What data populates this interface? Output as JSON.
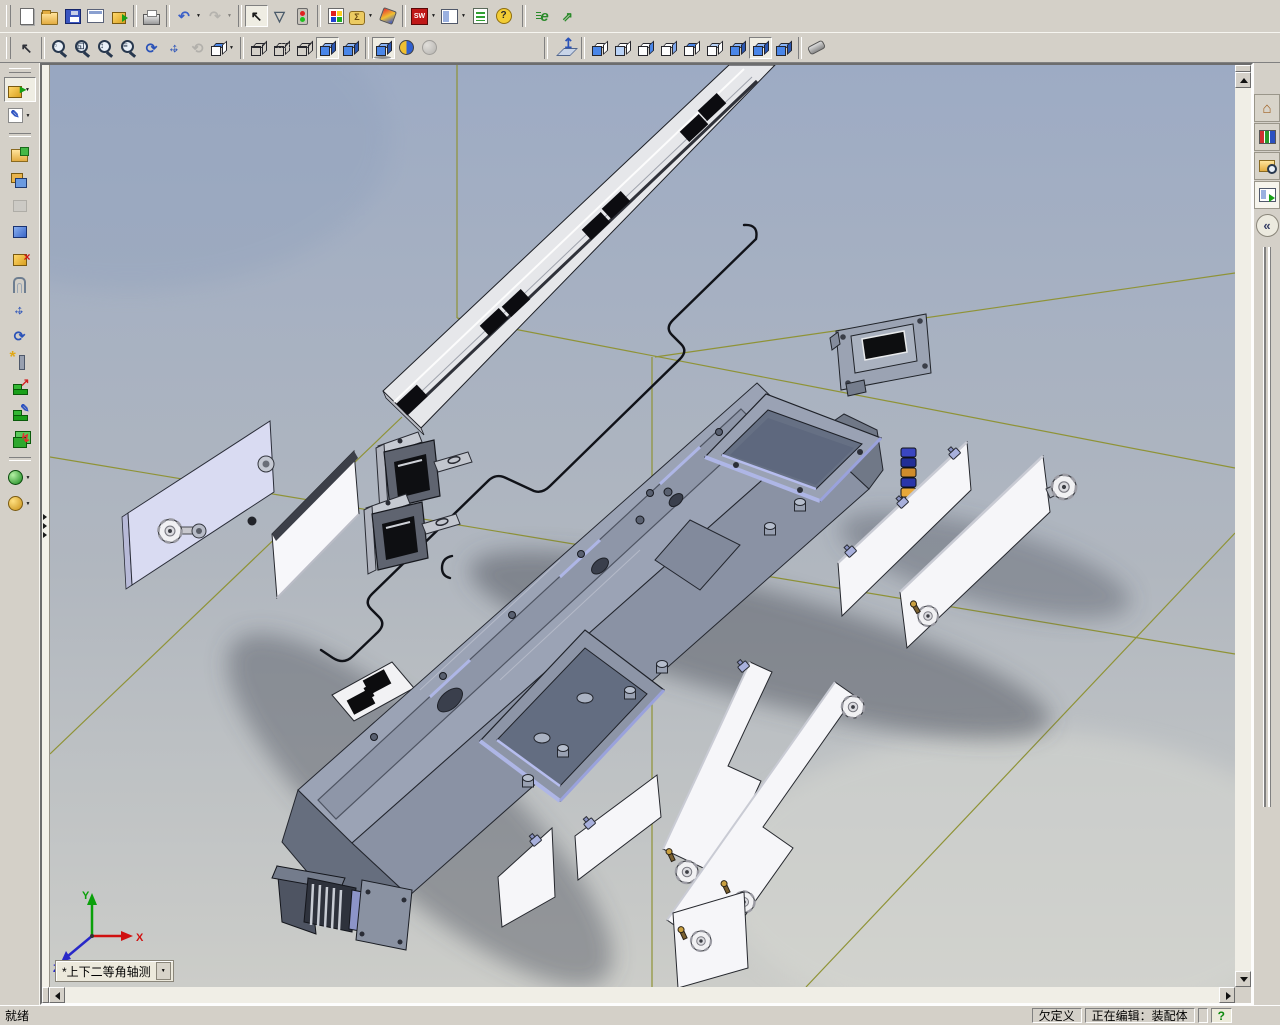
{
  "ui": {
    "dropdown_glyph": "▼"
  },
  "toolbar_main": {
    "items": [
      {
        "grip": true
      },
      {
        "name": "new-button",
        "icon": "new-document-icon",
        "kind": "page"
      },
      {
        "name": "open-button",
        "icon": "open-folder-icon",
        "kind": "folder"
      },
      {
        "name": "save-button",
        "icon": "save-disk-icon",
        "kind": "disk"
      },
      {
        "name": "make-drawing-button",
        "icon": "make-drawing-icon",
        "kind": "drawing"
      },
      {
        "name": "make-assembly-button",
        "icon": "make-assembly-icon",
        "kind": "partgreen"
      },
      {
        "sep": true
      },
      {
        "name": "print-button",
        "icon": "printer-icon",
        "kind": "print"
      },
      {
        "sep": true
      },
      {
        "name": "undo-button",
        "icon": "undo-arrow-icon",
        "char": "↶",
        "color": "#3a5fc8",
        "dropdown": true
      },
      {
        "name": "redo-button",
        "icon": "redo-arrow-icon",
        "char": "↷",
        "color": "#90908a",
        "disabled": true,
        "dropdown": true
      },
      {
        "sep": true
      },
      {
        "name": "select-button",
        "icon": "cursor-arrow-icon",
        "char": "↖",
        "color": "#1a1a1a",
        "pressed": true
      },
      {
        "name": "selection-filter-button",
        "icon": "filter-funnel-icon",
        "char": "▽",
        "color": "#4a5a6a"
      },
      {
        "name": "rebuild-button",
        "icon": "traffic-light-icon",
        "kind": "traffic"
      },
      {
        "sep": true
      },
      {
        "name": "edit-color-button",
        "icon": "color-palette-icon",
        "kind": "palette"
      },
      {
        "name": "measure-button",
        "icon": "measure-tape-icon",
        "kind": "measure",
        "char": "Σ",
        "color": "#6a4a10",
        "dropdown": true
      },
      {
        "name": "photoworks-button",
        "icon": "render-icon",
        "kind": "pworks"
      },
      {
        "sep": true
      },
      {
        "name": "solidworks-office-button",
        "icon": "solidworks-logo-icon",
        "kind": "sw",
        "char": "SW",
        "color": "#ffffff",
        "dropdown": true
      },
      {
        "name": "view-layout-button",
        "icon": "split-window-icon",
        "kind": "window",
        "dropdown": true
      },
      {
        "name": "options-button",
        "icon": "options-list-icon",
        "kind": "options"
      },
      {
        "name": "help-button",
        "icon": "help-question-icon",
        "kind": "help",
        "char": "?",
        "color": "#2a2a2a"
      },
      {
        "bigsep": true
      },
      {
        "name": "edrawings-button",
        "icon": "edrawings-e-icon",
        "kind": "e",
        "char": "e",
        "color": "#2a8a2a"
      },
      {
        "name": "web-publish-button",
        "icon": "web-arrows-icon",
        "kind": "web",
        "char": "⇗",
        "color": "#2a8a2a"
      }
    ]
  },
  "toolbar_view": {
    "items": [
      {
        "grip": true
      },
      {
        "name": "select-tool-button",
        "icon": "cursor-spring-icon",
        "char": "↖",
        "color": "#2e3038"
      },
      {
        "sep": true
      },
      {
        "name": "zoom-fit-button",
        "icon": "magnifier-fit-icon",
        "kind": "mag",
        "char": "▫"
      },
      {
        "name": "zoom-area-button",
        "icon": "magnifier-area-icon",
        "kind": "mag",
        "char": "◱"
      },
      {
        "name": "zoom-in-out-button",
        "icon": "magnifier-inout-icon",
        "kind": "mag",
        "char": "↕"
      },
      {
        "name": "zoom-selection-button",
        "icon": "magnifier-selection-icon",
        "kind": "mag",
        "char": "≡"
      },
      {
        "name": "rotate-view-button",
        "icon": "rotate-arrows-icon",
        "char": "⟳",
        "color": "#2a52b8"
      },
      {
        "name": "pan-button",
        "icon": "pan-arrows-icon",
        "kind": "pan"
      },
      {
        "name": "rotate-about-axis-button",
        "icon": "orbit-icon",
        "char": "⟲",
        "color": "#8a8a86",
        "disabled": true
      },
      {
        "name": "standard-views-button",
        "icon": "views-cube-icon",
        "cube": "faceT",
        "dropdown": true
      },
      {
        "sep": true
      },
      {
        "name": "wireframe-button",
        "icon": "wireframe-cube-icon",
        "cube": "wire"
      },
      {
        "name": "hidden-lines-visible-button",
        "icon": "hlv-cube-icon",
        "cube": "hlv"
      },
      {
        "name": "hidden-lines-removed-button",
        "icon": "hlr-cube-icon",
        "cube": "wire"
      },
      {
        "name": "shaded-with-edges-button",
        "icon": "shaded-edges-cube-icon",
        "cube": "edge",
        "pressed": true
      },
      {
        "name": "shaded-button",
        "icon": "shaded-cube-icon",
        "cube": "solid"
      },
      {
        "sep": true
      },
      {
        "name": "shadows-button",
        "icon": "shadow-cube-icon",
        "cube": "shadow",
        "pressed": true
      },
      {
        "name": "section-view-button",
        "icon": "section-view-icon",
        "kind": "section"
      },
      {
        "name": "realview-button",
        "icon": "realview-sphere-icon",
        "kind": "sphere",
        "disabled": true
      },
      {
        "gap": 96
      },
      {
        "bigsep": true
      },
      {
        "name": "normal-to-button",
        "icon": "normal-to-icon",
        "kind": "normalto",
        "char": "↥",
        "color": "#2a52b8"
      },
      {
        "sep": true
      },
      {
        "name": "front-view-button",
        "icon": "front-view-cube-icon",
        "cube": "faceF"
      },
      {
        "name": "back-view-button",
        "icon": "back-view-cube-icon",
        "cube": "faceB"
      },
      {
        "name": "left-view-button",
        "icon": "left-view-cube-icon",
        "cube": "faceL"
      },
      {
        "name": "right-view-button",
        "icon": "right-view-cube-icon",
        "cube": "faceR"
      },
      {
        "name": "top-view-button",
        "icon": "top-view-cube-icon",
        "cube": "faceT"
      },
      {
        "name": "bottom-view-button",
        "icon": "bottom-view-cube-icon",
        "cube": "faceBT"
      },
      {
        "name": "isometric-view-button",
        "icon": "isometric-cube-icon",
        "cube": "solid"
      },
      {
        "name": "dimetric-view-button",
        "icon": "dimetric-cube-icon",
        "cube": "solid",
        "pressed": true
      },
      {
        "name": "trimetric-view-button",
        "icon": "trimetric-cube-icon",
        "cube": "solid"
      },
      {
        "sep": true
      },
      {
        "name": "view-orientation-button",
        "icon": "view-orientation-icon",
        "kind": "torch"
      }
    ]
  },
  "toolbar_assembly": {
    "items": [
      {
        "grip": true
      },
      {
        "name": "insert-component-button",
        "icon": "insert-component-icon",
        "kind": "part",
        "char": "▸",
        "color": "#13a013",
        "pressed": true,
        "dropdown": true
      },
      {
        "name": "sketch-button",
        "icon": "sketch-pencil-icon",
        "kind": "white",
        "char": "✎",
        "color": "#2a50c0",
        "dropdown": true
      },
      {
        "sep": true
      },
      {
        "name": "open-part-button",
        "icon": "folder-part-icon",
        "kind": "folderpart"
      },
      {
        "name": "replace-components-button",
        "icon": "components-icon",
        "kind": "parts2"
      },
      {
        "name": "hide-show-components-button",
        "icon": "hidden-component-icon",
        "kind": "partg",
        "disabled": true
      },
      {
        "name": "edit-component-button",
        "icon": "edit-component-icon",
        "kind": "partb"
      },
      {
        "name": "no-external-references-button",
        "icon": "no-references-icon",
        "kind": "part",
        "char": "×",
        "color": "#d01818"
      },
      {
        "name": "mate-button",
        "icon": "paperclip-icon",
        "kind": "clip"
      },
      {
        "name": "move-component-button",
        "icon": "move-component-icon",
        "kind": "pan"
      },
      {
        "name": "rotate-component-button",
        "icon": "rotate-component-icon",
        "char": "⟳",
        "color": "#2a52b8"
      },
      {
        "name": "smart-fasteners-button",
        "icon": "bolt-star-icon",
        "kind": "bolt",
        "char": "*",
        "color": "#e0a818"
      },
      {
        "name": "exploded-view-button",
        "icon": "exploded-view-icon",
        "kind": "steps",
        "char": "↗",
        "color": "#d02020"
      },
      {
        "name": "explode-line-sketch-button",
        "icon": "explode-line-icon",
        "kind": "steps",
        "char": "✎",
        "color": "#2a50c0"
      },
      {
        "name": "interference-detection-button",
        "icon": "interference-icon",
        "kind": "partgreen2",
        "char": "↯",
        "color": "#e03030"
      },
      {
        "sep": true
      },
      {
        "name": "simulation-button",
        "icon": "green-sphere-icon",
        "kind": "ball",
        "dropdown": true
      },
      {
        "name": "assemblyxpert-button",
        "icon": "gear-coin-icon",
        "kind": "coin",
        "dropdown": true
      }
    ]
  },
  "task_pane": {
    "tabs": [
      {
        "name": "solidworks-resources-tab",
        "icon": "home-icon"
      },
      {
        "name": "design-library-tab",
        "icon": "library-books-icon"
      },
      {
        "name": "file-explorer-tab",
        "icon": "folder-search-icon"
      },
      {
        "name": "view-palette-tab",
        "icon": "palette-window-icon",
        "active": true
      }
    ],
    "collapse_label": "«"
  },
  "viewport": {
    "view_orientation_label": "*上下二等角轴测",
    "triad": {
      "x_label": "X",
      "y_label": "Y",
      "z_label": "Z"
    },
    "colors": {
      "background_top": "#9dabc4",
      "background_bottom": "#cccdc9",
      "reference_lines": "#8f9336",
      "part_accent_lavender": "#aeb6e6",
      "panel_white": "#f6f6f9",
      "chassis_gray": "#9ba3b5",
      "shadow": "#4e545e"
    },
    "parts": [
      "linear-guide-rail",
      "rail-magnet-pads",
      "bent-cable",
      "cover-plate-left",
      "side-panel-left",
      "solenoid-actuator-1",
      "solenoid-actuator-2",
      "sensor-pad-plate",
      "main-chassis",
      "carriage-frame-upper",
      "carriage-frame-lower",
      "front-connector",
      "mounting-bracket",
      "screw-stack",
      "side-panel-right-1",
      "side-panel-right-2",
      "bottom-panel-1",
      "bottom-panel-2",
      "stepped-panel-1",
      "stepped-panel-2",
      "end-plate",
      "thumb-knobs",
      "origin-triad"
    ]
  },
  "status_bar": {
    "ready_text": "就绪",
    "constraint_badge": "欠定义",
    "editing_badge": "正在编辑：装配体",
    "help_button": "?"
  }
}
